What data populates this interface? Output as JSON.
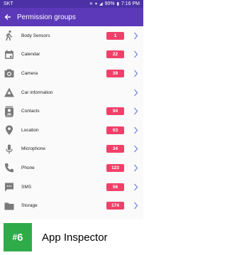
{
  "status_bar": {
    "carrier": "SKT",
    "battery": "90%",
    "time": "7:16 PM"
  },
  "app_bar": {
    "title": "Permission groups"
  },
  "colors": {
    "status_bar": "#4a31a5",
    "app_bar": "#5b39b9",
    "badge": "#f0406a",
    "icon": "#7a7a7a",
    "chevron": "#6a7fd8",
    "footer_badge": "#2fab4a"
  },
  "permission_groups": [
    {
      "label": "Body Sensors",
      "count": "1",
      "icon": "person-walk-icon"
    },
    {
      "label": "Calendar",
      "count": "22",
      "icon": "calendar-icon"
    },
    {
      "label": "Camera",
      "count": "39",
      "icon": "camera-icon"
    },
    {
      "label": "Car information",
      "count": null,
      "icon": "car-info-icon"
    },
    {
      "label": "Contacts",
      "count": "94",
      "icon": "contacts-icon"
    },
    {
      "label": "Location",
      "count": "63",
      "icon": "location-pin-icon"
    },
    {
      "label": "Microphone",
      "count": "34",
      "icon": "microphone-icon"
    },
    {
      "label": "Phone",
      "count": "123",
      "icon": "phone-icon"
    },
    {
      "label": "SMS",
      "count": "56",
      "icon": "sms-icon"
    },
    {
      "label": "Storage",
      "count": "174",
      "icon": "folder-icon"
    }
  ],
  "footer": {
    "rank_hash": "#",
    "rank": "6",
    "app_name": "App Inspector"
  }
}
